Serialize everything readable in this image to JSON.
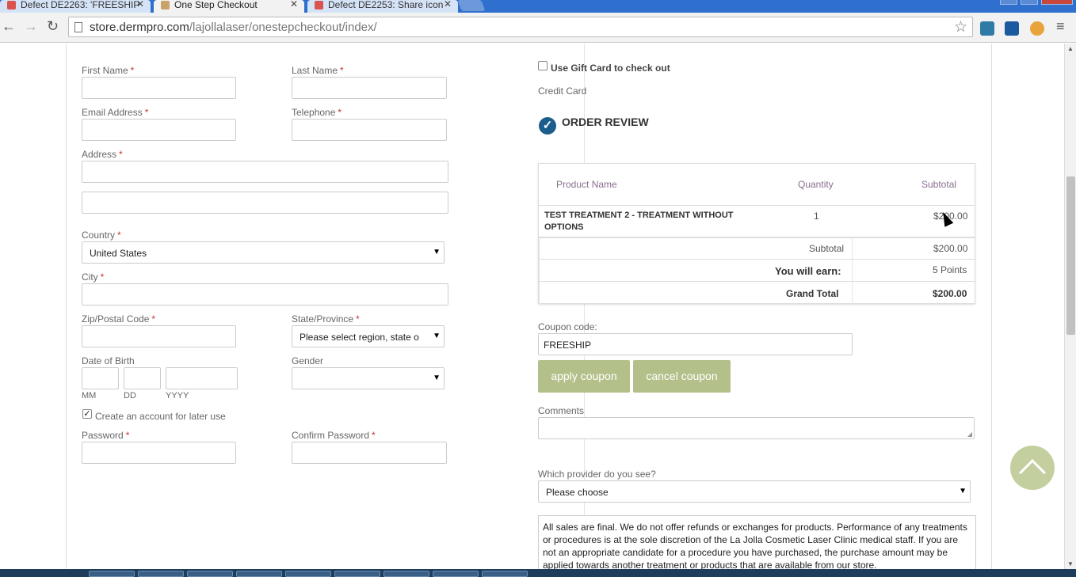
{
  "browser": {
    "tabs": [
      {
        "title": "Defect DE2263: 'FREESHIP",
        "active": false,
        "favicon_color": "#d9534f"
      },
      {
        "title": "One Step Checkout",
        "active": true,
        "favicon_color": "#c8a46a"
      },
      {
        "title": "Defect DE2253: Share icon",
        "active": false,
        "favicon_color": "#d9534f"
      }
    ],
    "tab_close_glyph": "✕",
    "url_host": "store.dermpro.com",
    "url_path": "/lajollalaser/onestepcheckout/index/",
    "extension_icons": [
      "#2e7ba6",
      "#1c5aa0",
      "#e8a33a"
    ]
  },
  "billing": {
    "first_name_label": "First Name",
    "last_name_label": "Last Name",
    "email_label": "Email Address",
    "telephone_label": "Telephone",
    "address_label": "Address",
    "country_label": "Country",
    "country_value": "United States",
    "city_label": "City",
    "zip_label": "Zip/Postal Code",
    "state_label": "State/Province",
    "state_value": "Please select region, state o",
    "dob_label": "Date of Birth",
    "dob_mm": "MM",
    "dob_dd": "DD",
    "dob_yyyy": "YYYY",
    "gender_label": "Gender",
    "create_account_label": "Create an account for later use",
    "create_account_checked": true,
    "password_label": "Password",
    "confirm_password_label": "Confirm Password",
    "required_mark": "*"
  },
  "payment": {
    "gift_card_label": "Use Gift Card to check out",
    "gift_card_checked": false,
    "method": "Credit Card"
  },
  "review": {
    "title": "ORDER REVIEW",
    "col_product": "Product Name",
    "col_quantity": "Quantity",
    "col_subtotal": "Subtotal",
    "item_name_line1": "TEST TREATMENT 2 - TREATMENT WITHOUT",
    "item_name_line2": "OPTIONS",
    "item_qty": "1",
    "item_subtotal": "$200.00",
    "subtotal_label": "Subtotal",
    "subtotal_value": "$200.00",
    "earn_label": "You will earn:",
    "earn_value": "5 Points",
    "grand_total_label": "Grand Total",
    "grand_total_value": "$200.00"
  },
  "coupon": {
    "label": "Coupon code:",
    "value": "FREESHIP",
    "apply_label": "apply coupon",
    "cancel_label": "cancel coupon"
  },
  "comments_label": "Comments",
  "provider": {
    "label": "Which provider do you see?",
    "value": "Please choose"
  },
  "terms": "All sales are final. We do not offer refunds or exchanges for products. Performance of any treatments or procedures is at the sole discretion of the La Jolla Cosmetic Laser Clinic medical staff. If you are not an appropriate candidate for a procedure you have purchased, the purchase amount may be applied towards another treatment or products that are available from our store.",
  "colors": {
    "button_bg": "#b4c08a",
    "totop_bg": "#c3cf9e",
    "check_icon_bg": "#1b5e8c",
    "required": "#cc3333",
    "tab_bar": "#2f6fce"
  }
}
